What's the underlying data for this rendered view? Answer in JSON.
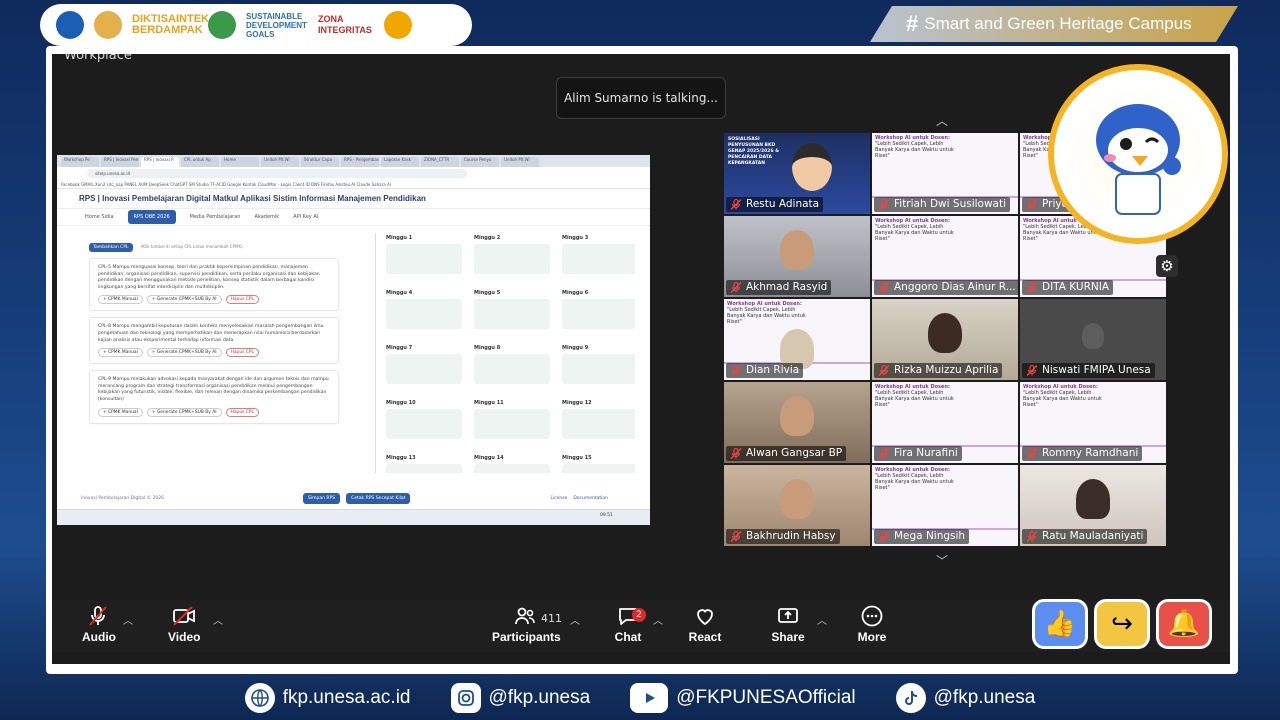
{
  "header": {
    "logos": [
      "DIKTISAINTEK BERDAMPAK",
      "SUSTAINABLE DEVELOPMENT GOALS",
      "ZONA INTEGRITAS"
    ],
    "tagline_hash": "#",
    "tagline": "Smart and Green Heritage Campus"
  },
  "meeting": {
    "window_title": "Workplace",
    "talking": "Alim Sumarno is talking..."
  },
  "shared_screen": {
    "tabs": [
      "Workshop Pe",
      "RPS | Inovasi Pem",
      "RPS | Inovasi P",
      "CPL untuk Ap",
      "Home",
      "Unduh Mt.Wi",
      "Struktur Capa",
      "RPS - Pengemban",
      "Laporan Kask",
      "ZIONA_CTTR",
      "Course Penyu",
      "Unduh Mt.Wi"
    ],
    "url": "sitelp.unesa.ac.id",
    "bookmarks": "Facebook  GMAIL  Xun2  sitc_nap  PANEL AUM  DeepSeek  ChatGPT  SM Studio  TF-ACID  Google Kontak  CloudMar - Login  Client ID  DNS Firefox  Asisteu AI  Claude  Sahara AI",
    "app_title": "RPS | Inovasi Pembelajaran Digital Matkul Aplikasi Sistim Informasi Manajemen Pendidikan",
    "nav": [
      "Home Sidia",
      "RPS OBE 2026",
      "Media Pembelajaran",
      "Akademik",
      "API Key AI"
    ],
    "add_cpl": "Tambahkan CPL",
    "add_cpl_hint": "(Klik tombol di setiap CPL untuk menambah CPMK)",
    "cpl_cards": [
      {
        "text": "CPL-5 Mampu menguasai konsep, teori dan praktik kepemimpinan pendidikan, manajemen pendidikan, organisasi pendidikan, supervisi pendidikan, serta perilaku organisasi dan kebijakan pendidikan dengan menggunakan metode penelitian, konsep statistik dalam berbagai kondisi lingkungan yang bersifat interdisiplin dan multidisiplin.",
        "btns": [
          "+ CPMK Manual",
          "+ Generate CPMK+SUB By AI",
          "Hapus CPL"
        ]
      },
      {
        "text": "CPL-8 Mampu mengambil keputusan dalam konteks menyelesaikan masalah pengembangan ilmu pengetahuan dan teknologi yang memperhatikan dan menerapkan nilai humaniora berdasarkan kajian analisis atau eksperimental terhadap informasi data",
        "btns": [
          "+ CPMK Manual",
          "+ Generate CPMK+SUB By AI",
          "Hapus CPL"
        ]
      },
      {
        "text": "CPL-9 Mampu melakukan advokasi kepada masyarakat dengan ide dan argumen teknis dan mampu merancang program dan strategi transformasi organisasi pendidikan melalui pengembangan kebijakan yang futuristik, visible, flexible, dan relevan dengan dinamika perkembangan pendidikan (konsultan)",
        "btns": [
          "+ CPMK Manual",
          "+ Generate CPMK+SUB By AI",
          "Hapus CPL"
        ]
      }
    ],
    "weeks": [
      "Minggu 1",
      "Minggu 2",
      "Minggu 3",
      "Minggu 4",
      "Minggu 5",
      "Minggu 6",
      "Minggu 7",
      "Minggu 8",
      "Minggu 9",
      "Minggu 10",
      "Minggu 11",
      "Minggu 12",
      "Minggu 13",
      "Minggu 14",
      "Minggu 15"
    ],
    "footer": "Inovasi Pembelajaran Digital © 2026",
    "save_btn": "Simpan RPS",
    "print_btn": "Cetak RPS Secepat Kilat",
    "footer_links": [
      "License",
      "Documentation"
    ],
    "clock": "09.51"
  },
  "participants": [
    {
      "name": "Restu Adinata",
      "kind": "blue"
    },
    {
      "name": "Fitriah Dwi Susilowati",
      "kind": "slide"
    },
    {
      "name": "Priyo Heru Adi",
      "kind": "slide"
    },
    {
      "name": "Akhmad Rasyid",
      "kind": "cam1"
    },
    {
      "name": "Anggoro Dias Ainur R...",
      "kind": "slide"
    },
    {
      "name": "DITA KURNIA",
      "kind": "slide"
    },
    {
      "name": "Dian Rivia",
      "kind": "slide-face"
    },
    {
      "name": "Rizka Muizzu Aprilia",
      "kind": "cam2"
    },
    {
      "name": "Niswati FMIPA Unesa",
      "kind": "dark"
    },
    {
      "name": "Alwan Gangsar BP",
      "kind": "cam4"
    },
    {
      "name": "Fira Nurafini",
      "kind": "slide"
    },
    {
      "name": "Rommy Ramdhani",
      "kind": "slide"
    },
    {
      "name": "Bakhrudin Habsy",
      "kind": "cam5"
    },
    {
      "name": "Mega Ningsih",
      "kind": "slide"
    },
    {
      "name": "Ratu Mauladaniyati",
      "kind": "cam6"
    }
  ],
  "slide_text": "Workshop AI untuk Dosen:",
  "slide_sub": "\"Lebih Sedikit Capek, Lebih Banyak Karya dan Waktu untuk Riset\"",
  "blue_slide": "SOSIALISASI PENYUSUNAN BKD GENAP 2025/2026 & PENCAIRAN DATA KEPANGKATAN",
  "toolbar": {
    "audio": "Audio",
    "video": "Video",
    "participants": "Participants",
    "participants_count": "411",
    "chat": "Chat",
    "chat_badge": "2",
    "react": "React",
    "share": "Share",
    "more": "More"
  },
  "socials": {
    "web": "fkp.unesa.ac.id",
    "instagram": "@fkp.unesa",
    "youtube": "@FKPUNESAOfficial",
    "tiktok": "@fkp.unesa"
  }
}
